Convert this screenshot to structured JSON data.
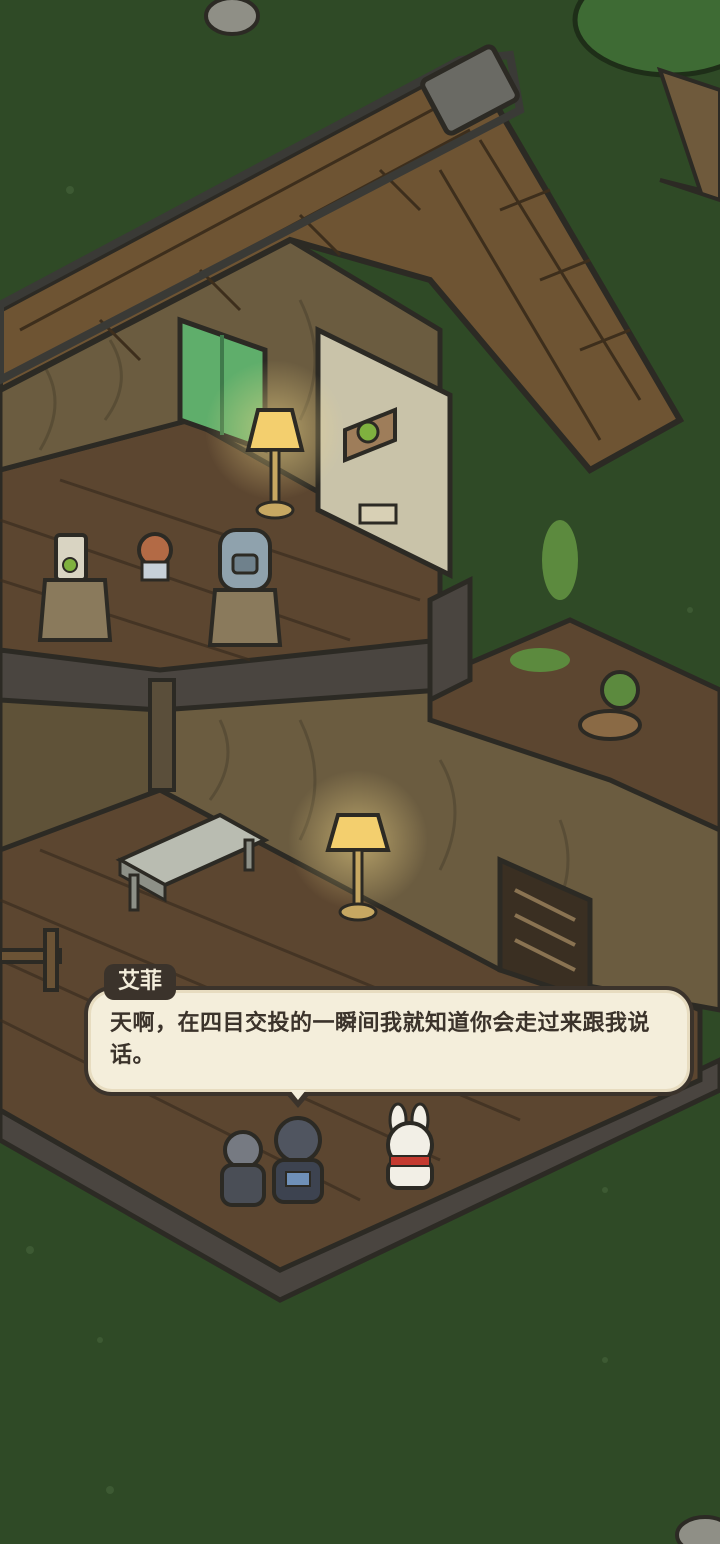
{
  "dialog": {
    "speaker": "艾菲",
    "text": "天啊，在四目交投的一瞬间我就知道你会走过来跟我说话。"
  },
  "colors": {
    "grass": "#2f4a26",
    "wood_floor": "#6b5335",
    "wall": "#7a6a4a",
    "roof": "#6e5433",
    "dialog_bg": "#f4eedb",
    "dialog_border": "#3b332b",
    "lamp_glow": "#f3d27a"
  },
  "icons": {
    "lamp": "lamp-icon",
    "backpack": "backpack-icon",
    "plant_box": "plant-box-icon",
    "cat_figurine": "cat-figurine-icon"
  }
}
